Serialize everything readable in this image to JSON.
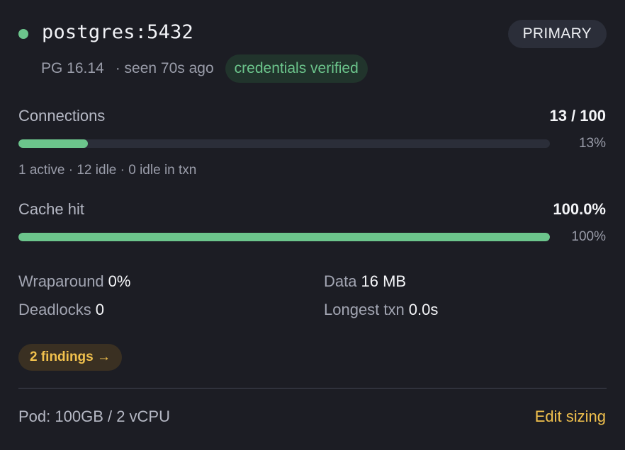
{
  "server": {
    "host": "postgres:5432",
    "role": "PRIMARY",
    "status_color": "#6cc58c",
    "version": "PG 16.14",
    "seen": "· seen 70s ago",
    "credentials": "credentials verified"
  },
  "connections": {
    "label": "Connections",
    "value": "13 / 100",
    "percent_label": "13%",
    "fill_fraction": 0.13,
    "detail": "1 active · 12 idle · 0 idle in txn"
  },
  "cache": {
    "label": "Cache hit",
    "value": "100.0%",
    "percent_label": "100%",
    "fill_fraction": 1.0
  },
  "stats": {
    "wraparound_label": "Wraparound",
    "wraparound_value": "0%",
    "data_label": "Data",
    "data_value": "16 MB",
    "deadlocks_label": "Deadlocks",
    "deadlocks_value": "0",
    "longest_txn_label": "Longest txn",
    "longest_txn_value": "0.0s"
  },
  "findings": "2 findings →",
  "footer": {
    "pod": "Pod: 100GB / 2 vCPU",
    "edit": "Edit sizing"
  },
  "colors": {
    "background": "#1c1d24",
    "accent_green": "#6cc58c",
    "accent_yellow": "#f1c14d"
  }
}
